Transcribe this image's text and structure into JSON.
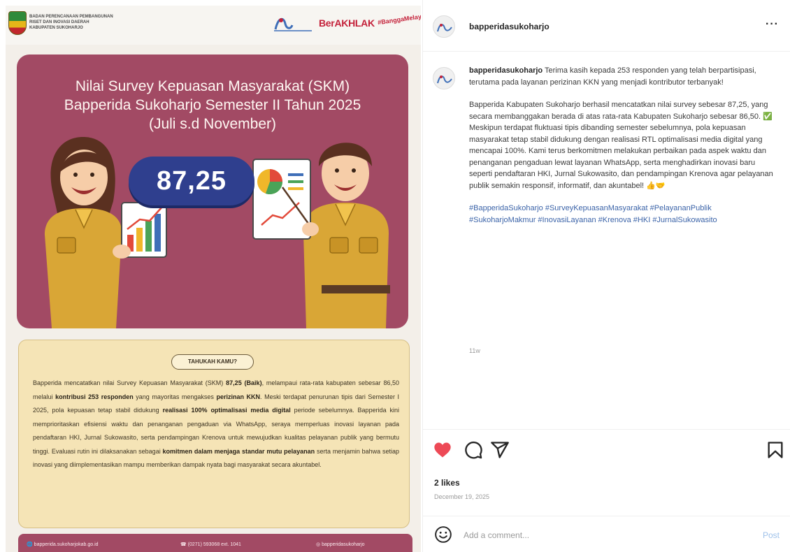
{
  "image": {
    "agency_lines": [
      "BADAN PERENCANAAN PEMBANGUNAN",
      "RISET DAN INOVASI DAERAH",
      "KABUPATEN SUKOHARJO"
    ],
    "berakhlak_logo": "BerAKHLAK",
    "berakhlak_sub": "#BanggaMelayani",
    "title_lines": [
      "Nilai Survey Kepuasan Masyarakat (SKM)",
      "Bapperida Sukoharjo Semester II Tahun 2025",
      "(Juli s.d November)"
    ],
    "score": "87,25",
    "tahukah_label": "TAHUKAH KAMU?",
    "info_segments": [
      {
        "t": "Bapperida mencatatkan nilai Survey Kepuasan Masyarakat (SKM) ",
        "b": false
      },
      {
        "t": "87,25 (Baik)",
        "b": true
      },
      {
        "t": ", melampaui rata-rata kabupaten sebesar 86,50 melalui ",
        "b": false
      },
      {
        "t": "kontribusi 253 responden",
        "b": true
      },
      {
        "t": " yang mayoritas mengakses ",
        "b": false
      },
      {
        "t": "perizinan KKN",
        "b": true
      },
      {
        "t": ". Meski terdapat penurunan tipis dari Semester I 2025, pola kepuasan tetap stabil didukung ",
        "b": false
      },
      {
        "t": "realisasi 100% optimalisasi media digital",
        "b": true
      },
      {
        "t": " periode sebelumnya. Bapperida kini memprioritaskan efisiensi waktu dan penanganan pengaduan via WhatsApp, seraya memperluas inovasi layanan pada pendaftaran HKI, Jurnal Sukowasito, serta pendampingan Krenova untuk mewujudkan kualitas pelayanan publik yang bermutu tinggi. Evaluasi rutin ini dilaksanakan sebagai ",
        "b": false
      },
      {
        "t": "komitmen dalam menjaga standar mutu pelayanan",
        "b": true
      },
      {
        "t": " serta menjamin bahwa setiap inovasi yang diimplementasikan mampu memberikan dampak nyata bagi masyarakat secara akuntabel.",
        "b": false
      }
    ],
    "footer": {
      "website": "bapperida.sukoharjokab.go.id",
      "phone": "(0271) 593068 ext. 1041",
      "instagram": "bapperidasukoharjo"
    }
  },
  "post": {
    "username": "bapperidasukoharjo",
    "caption_p1": "Terima kasih kepada 253 responden yang telah berpartisipasi, terutama pada layanan perizinan KKN yang menjadi kontributor terbanyak!",
    "caption_p2": "Bapperida Kabupaten Sukoharjo berhasil mencatatkan nilai survey sebesar 87,25, yang secara membanggakan berada di atas rata-rata Kabupaten Sukoharjo sebesar 86,50. ✅ Meskipun terdapat fluktuasi tipis dibanding semester sebelumnya, pola kepuasan masyarakat tetap stabil didukung dengan realisasi RTL optimalisasi media digital yang mencapai 100%. Kami terus berkomitmen melakukan perbaikan pada aspek waktu dan penanganan pengaduan lewat layanan WhatsApp, serta menghadirkan inovasi baru seperti pendaftaran HKI, Jurnal Sukowasito, dan pendampingan Krenova agar pelayanan publik semakin responsif, informatif, dan akuntabel! 👍🤝",
    "hashtags": "#BapperidaSukoharjo #SurveyKepuasanMasyarakat #PelayananPublik #SukoharjoMakmur #InovasiLayanan #Krenova #HKI #JurnalSukowasito",
    "time_ago": "11w",
    "likes": "2 likes",
    "date": "December 19, 2025",
    "comment_placeholder": "Add a comment...",
    "post_label": "Post",
    "more_label": "···"
  },
  "colors": {
    "maroon": "#a24a64",
    "score_pill": "#2f3f8e",
    "cream": "#f5e4b6",
    "like_red": "#ed4956",
    "hashtag_blue": "#3b63a8"
  },
  "icons": {
    "heart": "heart-icon",
    "comment": "comment-icon",
    "share": "share-icon",
    "save": "bookmark-icon",
    "emoji": "emoji-icon",
    "more": "more-icon"
  }
}
